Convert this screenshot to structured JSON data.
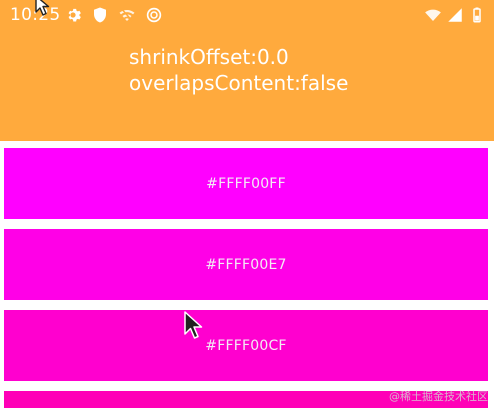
{
  "status_bar": {
    "time": "10:25",
    "left_icons": [
      "gear-icon",
      "shield-icon",
      "no-signal-icon",
      "sync-icon"
    ],
    "right_icons": [
      "wifi-icon",
      "cell-signal-icon",
      "battery-icon"
    ]
  },
  "header": {
    "background": "#FFAA3D",
    "line1": "shrinkOffset:0.0",
    "line2": "overlapsContent:false"
  },
  "color_list": {
    "items": [
      {
        "label": "#FFFF00FF",
        "color": "#FF00FF"
      },
      {
        "label": "#FFFF00E7",
        "color": "#FF00E7"
      },
      {
        "label": "#FFFF00CF",
        "color": "#FF00CF"
      },
      {
        "label": "",
        "color": "#FF00B7"
      }
    ]
  },
  "watermark": {
    "text": "@稀土掘金技术社区"
  }
}
